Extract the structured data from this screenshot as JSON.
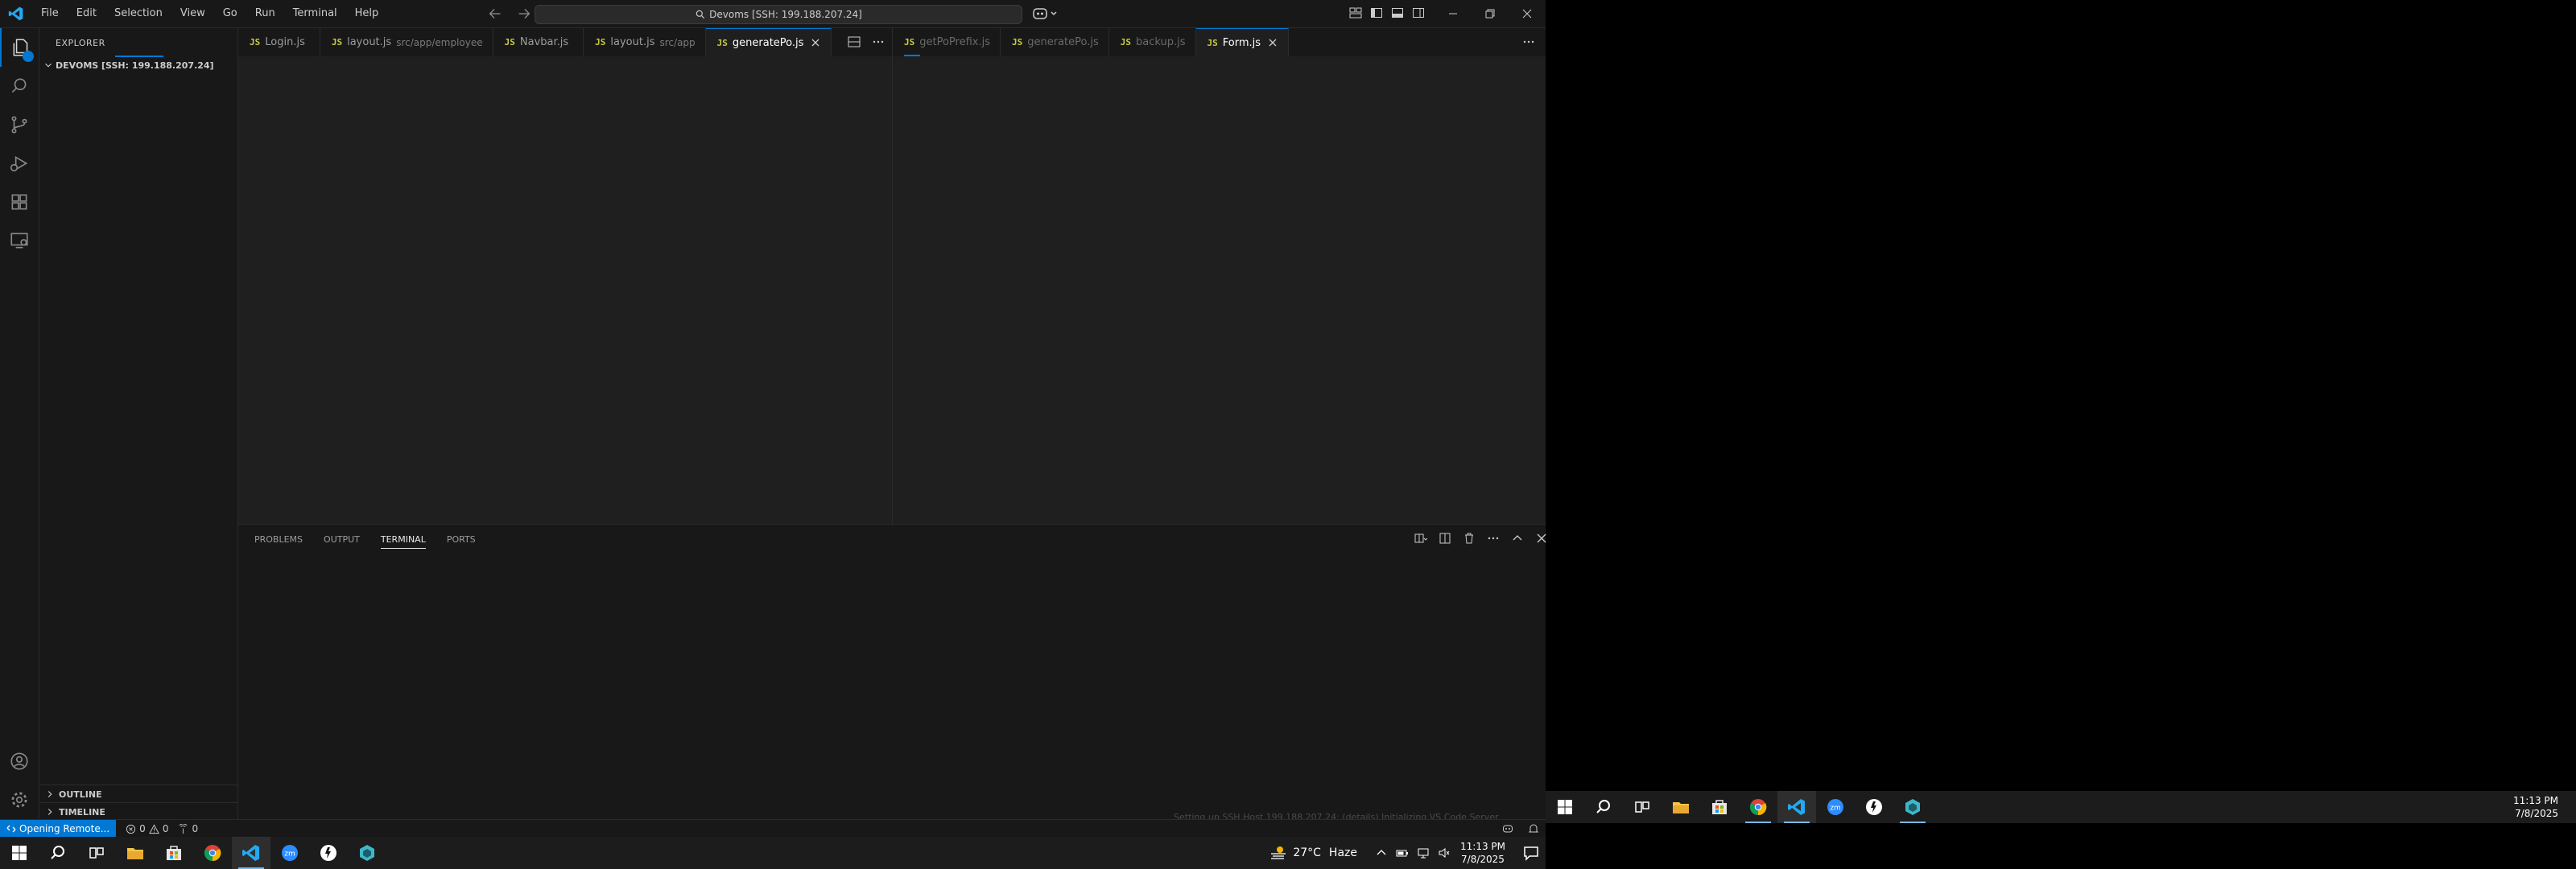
{
  "titlebar": {
    "menu": [
      "File",
      "Edit",
      "Selection",
      "View",
      "Go",
      "Run",
      "Terminal",
      "Help"
    ],
    "command_center": "Devoms [SSH: 199.188.207.24]"
  },
  "sidebar": {
    "title": "EXPLORER",
    "root": "DEVOMS [SSH: 199.188.207.24]",
    "outline": "OUTLINE",
    "timeline": "TIMELINE"
  },
  "editor": {
    "left_group_tabs": [
      {
        "icon": "JS",
        "label": "Login.js",
        "desc": ""
      },
      {
        "icon": "JS",
        "label": "layout.js",
        "desc": "src/app/employee"
      },
      {
        "icon": "JS",
        "label": "Navbar.js",
        "desc": ""
      },
      {
        "icon": "JS",
        "label": "layout.js",
        "desc": "src/app"
      },
      {
        "icon": "JS",
        "label": "generatePo.js",
        "desc": ""
      }
    ],
    "right_group_tabs": [
      {
        "icon": "JS",
        "label": "getPoPrefix.js"
      },
      {
        "icon": "JS",
        "label": "generatePo.js"
      },
      {
        "icon": "JS",
        "label": "backup.js"
      },
      {
        "icon": "JS",
        "label": "Form.js"
      }
    ]
  },
  "panel": {
    "tabs": [
      "PROBLEMS",
      "OUTPUT",
      "TERMINAL",
      "PORTS"
    ],
    "active_tab": "TERMINAL",
    "notice": "Setting up SSH Host 199.188.207.24: (details) Initializing VS Code Server"
  },
  "statusbar": {
    "remote": "Opening Remote...",
    "errors": "0",
    "warnings": "0",
    "ports": "0"
  },
  "taskbar": {
    "weather_temp": "27°C",
    "weather_desc": "Haze",
    "time": "11:13 PM",
    "date": "7/8/2025"
  },
  "taskbar2": {
    "time": "11:13 PM",
    "date": "7/8/2025"
  },
  "colors": {
    "accent": "#0078d4",
    "js_icon": "#cbcb41",
    "editor_bg": "#1f1f1f",
    "chrome_bg": "#181818"
  }
}
